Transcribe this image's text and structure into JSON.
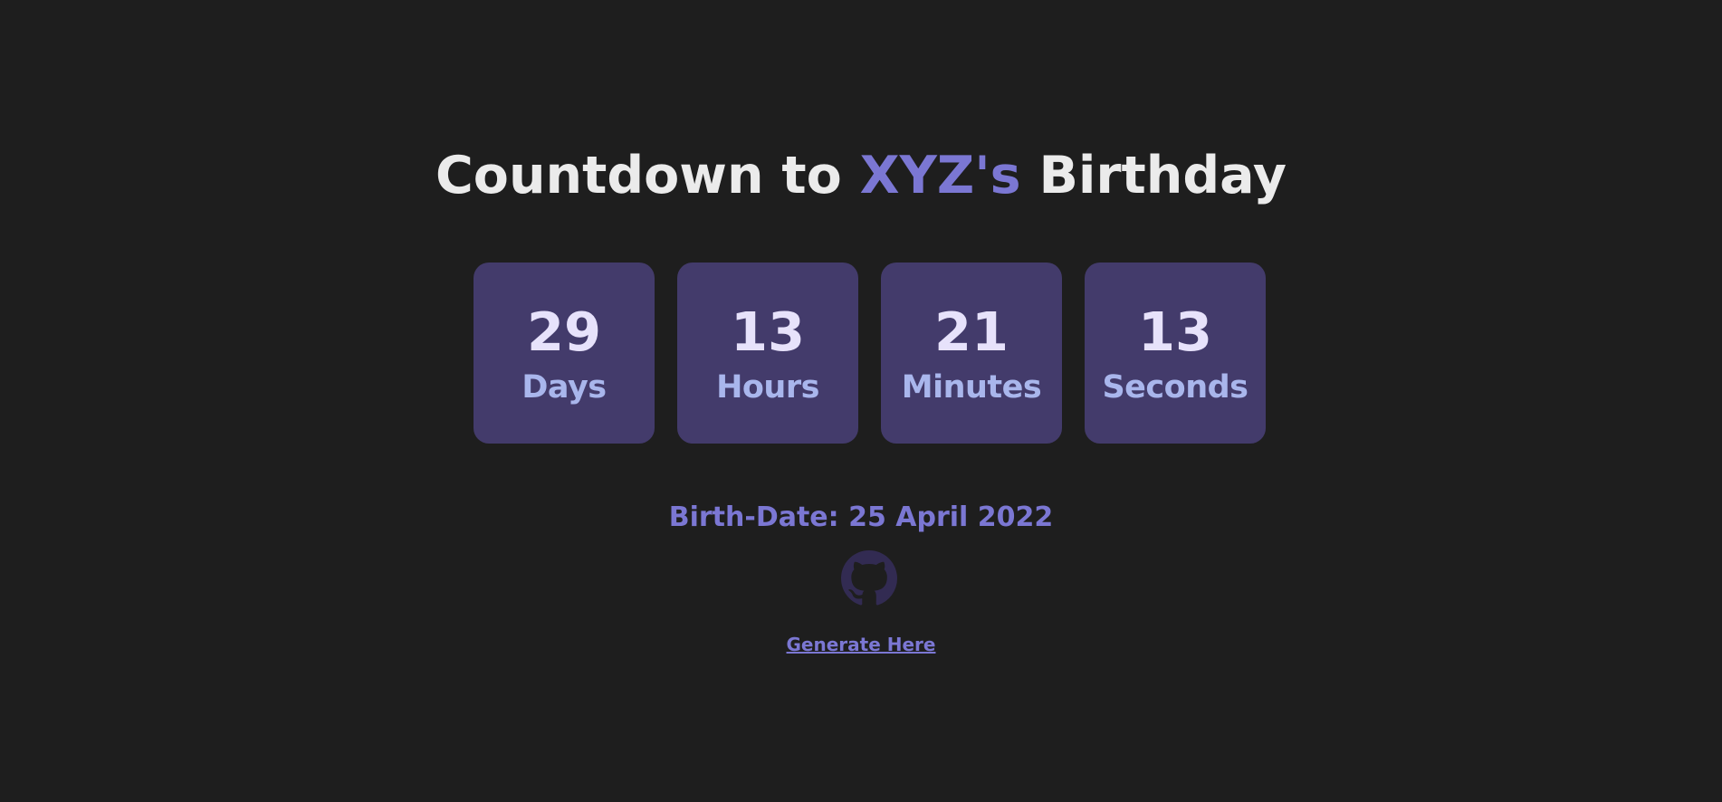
{
  "header": {
    "prefix": "Countdown to ",
    "name": "XYZ's",
    "suffix": " Birthday"
  },
  "countdown": [
    {
      "value": "29",
      "unit": "Days"
    },
    {
      "value": "13",
      "unit": "Hours"
    },
    {
      "value": "21",
      "unit": "Minutes"
    },
    {
      "value": "13",
      "unit": "Seconds"
    }
  ],
  "birth_date": "Birth-Date: 25 April 2022",
  "github": {
    "icon": "github-icon",
    "color": "#322b52"
  },
  "link": {
    "label": "Generate Here"
  },
  "colors": {
    "background": "#1e1e1e",
    "accent": "#7b77d3",
    "card": "#433b6b",
    "number": "#e7e2fb",
    "unit": "#a9b6ec",
    "title": "#ebebeb"
  }
}
